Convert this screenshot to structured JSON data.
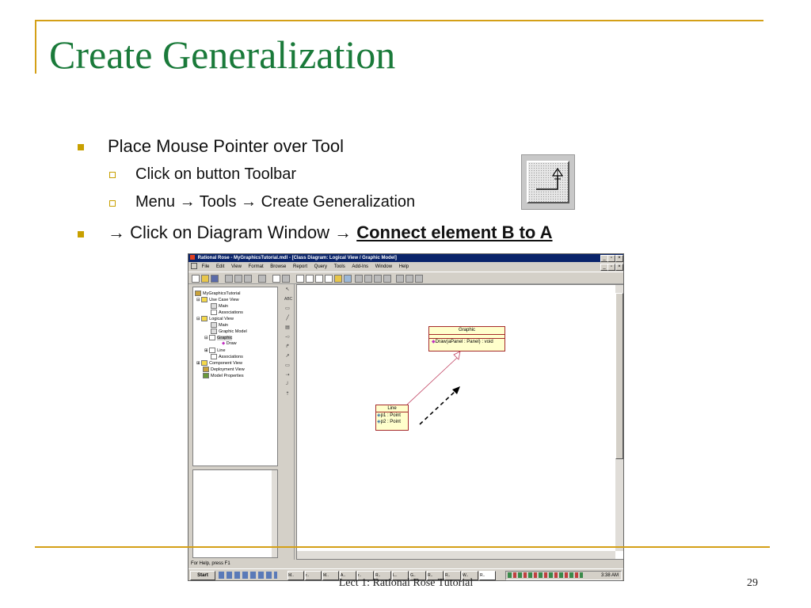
{
  "slide": {
    "title": "Create Generalization",
    "bullets": [
      {
        "text": "Place Mouse Pointer over Tool",
        "sub": [
          "Click on button Toolbar",
          "Menu → Tools → Create Generalization"
        ]
      },
      {
        "prefix": "→ Click on Diagram Window →",
        "emphasis": "Connect element B to A"
      }
    ],
    "footer": "Lect 1: Rational Rose Tutorial",
    "page_number": "29"
  },
  "tool_icon": {
    "icon": "generalization-tool-icon"
  },
  "screenshot": {
    "window_title": "Rational Rose - MyGraphicsTutorial.mdl - [Class Diagram: Logical View / Graphic Model]",
    "menu": [
      "File",
      "Edit",
      "View",
      "Format",
      "Browse",
      "Report",
      "Query",
      "Tools",
      "Add-Ins",
      "Window",
      "Help"
    ],
    "tree": [
      {
        "label": "MyGraphicsTutorial",
        "level": 0
      },
      {
        "label": "Use Case View",
        "level": 1
      },
      {
        "label": "Main",
        "level": 2
      },
      {
        "label": "Associations",
        "level": 2
      },
      {
        "label": "Logical View",
        "level": 1
      },
      {
        "label": "Main",
        "level": 2
      },
      {
        "label": "Graphic Model",
        "level": 2
      },
      {
        "label": "Graphic",
        "level": 2
      },
      {
        "label": "Draw",
        "level": 3
      },
      {
        "label": "Line",
        "level": 2
      },
      {
        "label": "Associations",
        "level": 2
      },
      {
        "label": "Component View",
        "level": 1
      },
      {
        "label": "Deployment View",
        "level": 1
      },
      {
        "label": "Model Properties",
        "level": 1
      }
    ],
    "class_graphic": {
      "name": "Graphic",
      "operation": "Draw(aPanel : Panel) : void"
    },
    "class_line": {
      "name": "Line",
      "attributes": [
        "p1 : Point",
        "p2 : Point"
      ]
    },
    "status": "For Help, press F1",
    "start": "Start",
    "clock": "3:38 AM",
    "tasks": [
      "M..",
      "r..",
      "M..",
      "A..",
      "r..",
      "R..",
      "L..",
      "G..",
      "R..",
      "R..",
      "W..",
      "R.."
    ]
  }
}
